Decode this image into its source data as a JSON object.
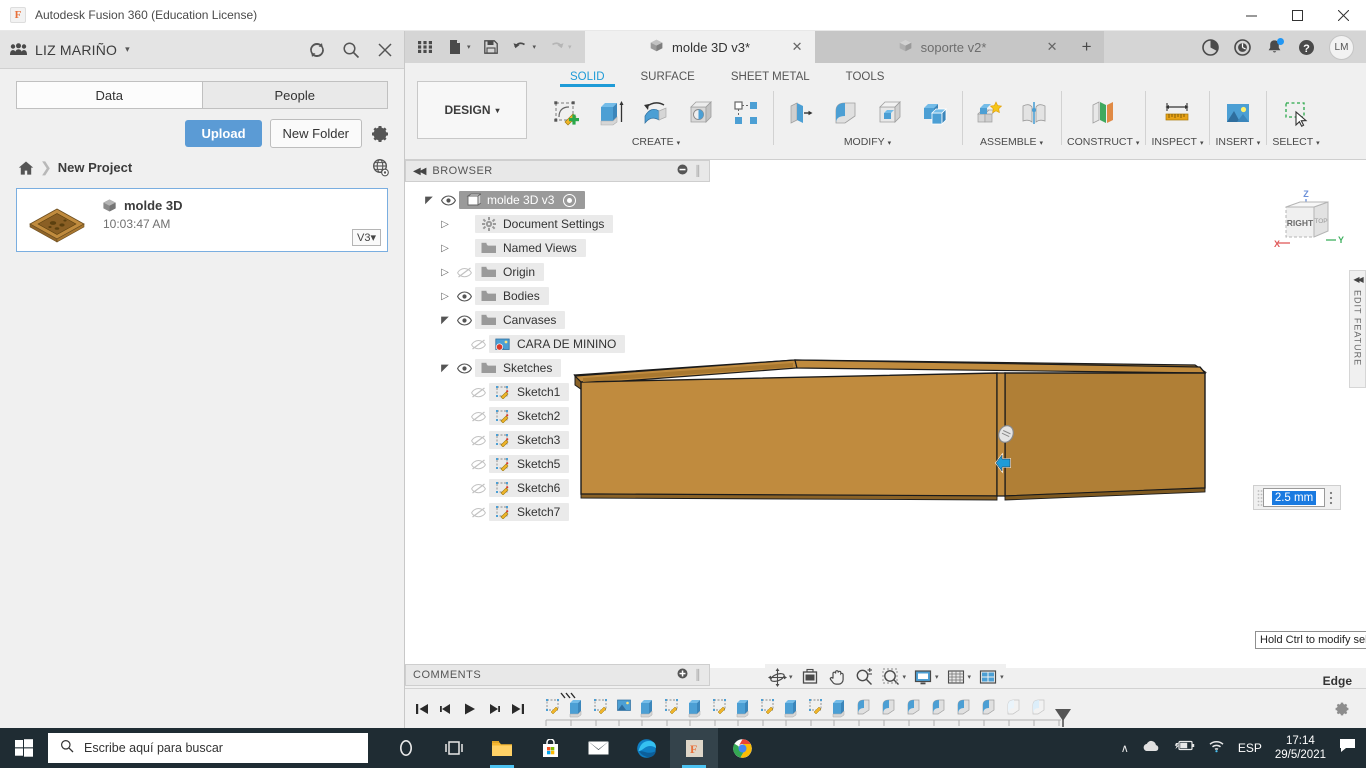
{
  "window": {
    "title": "Autodesk Fusion 360 (Education License)",
    "minimize": "─",
    "maximize": "☐",
    "close": "✕"
  },
  "data_panel": {
    "user": "LIZ MARIÑO",
    "user_caret": "▾",
    "header_icons": [
      "refresh-icon",
      "search-icon",
      "close-icon"
    ],
    "tabs": [
      {
        "label": "Data",
        "active": true
      },
      {
        "label": "People",
        "active": false
      }
    ],
    "upload_label": "Upload",
    "new_folder_label": "New Folder",
    "settings_icon": "gear-icon",
    "breadcrumb": {
      "home_icon": "home-icon",
      "separator": "❯",
      "project": "New Project",
      "globe_icon": "globe-icon"
    },
    "file": {
      "name": "molde 3D",
      "time": "10:03:47 AM",
      "version": "V3",
      "version_caret": "▾"
    }
  },
  "quick_access": {
    "grid_icon": "app-grid-icon",
    "new_icon": "new-document-icon",
    "save_icon": "save-icon",
    "undo_icon": "undo-icon",
    "redo_icon": "redo-icon",
    "caret": "▾",
    "doc_tabs": [
      {
        "label": "molde 3D v3*",
        "active": true,
        "close": "✕"
      },
      {
        "label": "soporte v2*",
        "active": false,
        "close": "✕"
      }
    ],
    "add_tab": "+",
    "right_icons": [
      "extensions-icon",
      "job-status-icon",
      "notifications-icon",
      "help-icon"
    ],
    "avatar_initials": "LM"
  },
  "ribbon": {
    "design_label": "DESIGN",
    "design_caret": "▾",
    "workspace_tabs": [
      {
        "label": "SOLID",
        "active": true
      },
      {
        "label": "SURFACE",
        "active": false
      },
      {
        "label": "SHEET METAL",
        "active": false
      },
      {
        "label": "TOOLS",
        "active": false
      }
    ],
    "panels": [
      {
        "label": "CREATE",
        "caret": "▾",
        "tools": [
          "create-sketch-icon",
          "extrude-icon",
          "revolve-icon",
          "hole-icon",
          "pattern-icon"
        ]
      },
      {
        "label": "MODIFY",
        "caret": "▾",
        "tools": [
          "press-pull-icon",
          "fillet-icon",
          "shell-icon",
          "combine-icon"
        ]
      },
      {
        "label": "ASSEMBLE",
        "caret": "▾",
        "tools": [
          "new-component-icon",
          "joint-icon"
        ]
      },
      {
        "label": "CONSTRUCT",
        "caret": "▾",
        "tools": [
          "offset-plane-icon"
        ]
      },
      {
        "label": "INSPECT",
        "caret": "▾",
        "tools": [
          "measure-icon"
        ]
      },
      {
        "label": "INSERT",
        "caret": "▾",
        "tools": [
          "insert-canvas-icon"
        ]
      },
      {
        "label": "SELECT",
        "caret": "▾",
        "tools": [
          "window-selection-icon"
        ]
      }
    ]
  },
  "browser": {
    "title": "BROWSER",
    "collapse_icon": "collapse-left-icon",
    "minus_icon": "minus-circle-icon",
    "nodes": [
      {
        "label": "molde 3D v3",
        "indent": 0,
        "arrow": "open",
        "eye": "visible",
        "icon": "component-icon",
        "selected": true,
        "radio": true
      },
      {
        "label": "Document Settings",
        "indent": 1,
        "arrow": "closed",
        "eye": "none",
        "icon": "settings-gear-icon",
        "selected": false,
        "radio": false
      },
      {
        "label": "Named Views",
        "indent": 1,
        "arrow": "closed",
        "eye": "none",
        "icon": "folder-icon",
        "selected": false,
        "radio": false
      },
      {
        "label": "Origin",
        "indent": 1,
        "arrow": "closed",
        "eye": "hidden",
        "icon": "folder-icon",
        "selected": false,
        "radio": false
      },
      {
        "label": "Bodies",
        "indent": 1,
        "arrow": "closed",
        "eye": "visible",
        "icon": "folder-icon",
        "selected": false,
        "radio": false
      },
      {
        "label": "Canvases",
        "indent": 1,
        "arrow": "open",
        "eye": "visible",
        "icon": "folder-icon",
        "selected": false,
        "radio": false
      },
      {
        "label": "CARA DE MININO",
        "indent": 2,
        "arrow": "none",
        "eye": "hidden",
        "icon": "canvas-image-icon",
        "selected": false,
        "radio": false
      },
      {
        "label": "Sketches",
        "indent": 1,
        "arrow": "open",
        "eye": "visible",
        "icon": "folder-icon",
        "selected": false,
        "radio": false
      },
      {
        "label": "Sketch1",
        "indent": 2,
        "arrow": "none",
        "eye": "hidden",
        "icon": "sketch-icon",
        "selected": false,
        "radio": false
      },
      {
        "label": "Sketch2",
        "indent": 2,
        "arrow": "none",
        "eye": "hidden",
        "icon": "sketch-icon",
        "selected": false,
        "radio": false
      },
      {
        "label": "Sketch3",
        "indent": 2,
        "arrow": "none",
        "eye": "hidden",
        "icon": "sketch-icon",
        "selected": false,
        "radio": false
      },
      {
        "label": "Sketch5",
        "indent": 2,
        "arrow": "none",
        "eye": "hidden",
        "icon": "sketch-icon",
        "selected": false,
        "radio": false
      },
      {
        "label": "Sketch6",
        "indent": 2,
        "arrow": "none",
        "eye": "hidden",
        "icon": "sketch-icon",
        "selected": false,
        "radio": false
      },
      {
        "label": "Sketch7",
        "indent": 2,
        "arrow": "none",
        "eye": "hidden",
        "icon": "sketch-icon",
        "selected": false,
        "radio": false
      }
    ]
  },
  "canvas": {
    "model_color": "#c08b3e",
    "view_cube": {
      "face": "RIGHT",
      "secondary_face": "TOP",
      "axis_x": "X",
      "axis_y": "Y",
      "axis_z": "Z"
    },
    "edit_feature_rail": {
      "arrows": "◀◀",
      "label": "EDIT FEATURE"
    },
    "value_input": {
      "value": "2.5 mm",
      "selected": true
    },
    "tooltip": "Hold Ctrl to modify sele"
  },
  "comments": {
    "title": "COMMENTS",
    "add_icon": "add-comment-icon"
  },
  "nav_bar": {
    "tools": [
      "orbit-icon",
      "look-at-icon",
      "pan-icon",
      "zoom-icon",
      "fit-icon",
      "display-settings-icon",
      "grid-snaps-icon",
      "viewports-icon"
    ],
    "caret": "▾"
  },
  "status_bar": {
    "selection_filter": "Edge"
  },
  "timeline": {
    "playback": [
      "skip-start-icon",
      "step-back-icon",
      "play-icon",
      "step-forward-icon",
      "skip-end-icon"
    ],
    "features": [
      "sketch-icon",
      "extrude-icon",
      "sketch-icon",
      "canvas-icon",
      "extrude-icon",
      "sketch-icon",
      "extrude-icon",
      "sketch-icon",
      "extrude-icon",
      "sketch-icon",
      "extrude-icon",
      "sketch-icon",
      "extrude-icon",
      "fillet-icon",
      "fillet-icon",
      "fillet-icon",
      "fillet-icon",
      "fillet-icon",
      "fillet-icon",
      "fillet-icon",
      "fillet-icon"
    ],
    "settings_icon": "gear-icon"
  },
  "taskbar": {
    "start_icon": "windows-start-icon",
    "search_icon": "search-icon",
    "search_placeholder": "Escribe aquí para buscar",
    "apps": [
      {
        "name": "cortana-icon",
        "active": false
      },
      {
        "name": "task-view-icon",
        "active": false
      },
      {
        "name": "file-explorer-icon",
        "active": false
      },
      {
        "name": "microsoft-store-icon",
        "active": false
      },
      {
        "name": "mail-icon",
        "active": false
      },
      {
        "name": "microsoft-edge-icon",
        "active": false
      },
      {
        "name": "fusion360-icon",
        "active": true
      },
      {
        "name": "google-chrome-icon",
        "active": false
      }
    ],
    "tray": {
      "chevron": "∧",
      "onedrive_icon": "cloud-icon",
      "battery_icon": "battery-charging-icon",
      "wifi_icon": "wifi-icon",
      "language": "ESP",
      "time": "17:14",
      "date": "29/5/2021",
      "action_center_icon": "action-center-icon"
    }
  }
}
